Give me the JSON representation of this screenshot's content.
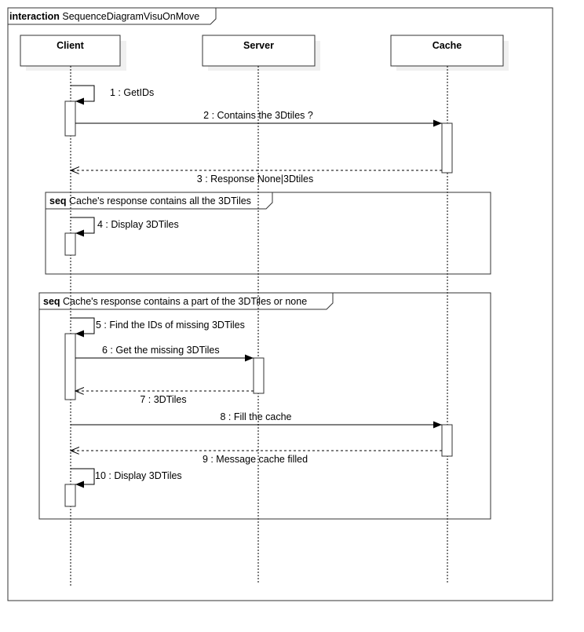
{
  "interaction": {
    "keyword": "interaction",
    "name": "SequenceDiagramVisuOnMove"
  },
  "lifelines": [
    {
      "id": "client",
      "label": "Client"
    },
    {
      "id": "server",
      "label": "Server"
    },
    {
      "id": "cache",
      "label": "Cache"
    }
  ],
  "fragments": [
    {
      "keyword": "seq",
      "label": "Cache's response contains all the 3DTiles"
    },
    {
      "keyword": "seq",
      "label": "Cache's response contains a part  of the 3DTiles or none"
    }
  ],
  "messages": [
    {
      "label": "1 : GetIDs",
      "kind": "self",
      "from": "client",
      "to": "client"
    },
    {
      "label": "2 : Contains the 3Dtiles ?",
      "kind": "sync",
      "from": "client",
      "to": "cache"
    },
    {
      "label": "3 : Response None|3Dtiles",
      "kind": "return",
      "from": "cache",
      "to": "client"
    },
    {
      "label": "4 : Display 3DTiles",
      "kind": "self",
      "from": "client",
      "to": "client"
    },
    {
      "label": "5 : Find the IDs of missing 3DTiles",
      "kind": "self",
      "from": "client",
      "to": "client"
    },
    {
      "label": "6 : Get the missing 3DTiles",
      "kind": "sync",
      "from": "client",
      "to": "server"
    },
    {
      "label": "7 : 3DTiles",
      "kind": "return",
      "from": "server",
      "to": "client"
    },
    {
      "label": "8 : Fill the cache",
      "kind": "sync",
      "from": "client",
      "to": "cache"
    },
    {
      "label": "9 : Message cache filled",
      "kind": "return",
      "from": "cache",
      "to": "client"
    },
    {
      "label": "10 : Display 3DTiles",
      "kind": "self",
      "from": "client",
      "to": "client"
    }
  ]
}
